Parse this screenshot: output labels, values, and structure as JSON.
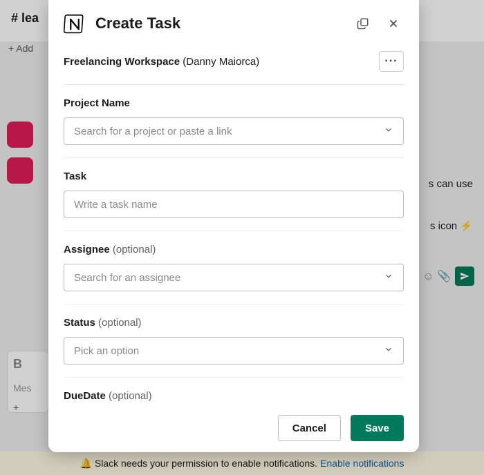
{
  "background": {
    "channel_prefix": "# lea",
    "add_label": "+  Add",
    "right_text_1": "s can use",
    "right_text_2": "s icon  ⚡",
    "composer_placeholder": "Mes",
    "notif_text": "Slack needs your permission to enable notifications.",
    "notif_link": "Enable notifications"
  },
  "modal": {
    "title": "Create Task",
    "workspace_name": "Freelancing Workspace",
    "workspace_user": "(Danny Maiorca)",
    "more_label": "···",
    "fields": {
      "project": {
        "label": "Project Name",
        "placeholder": "Search for a project or paste a link"
      },
      "task": {
        "label": "Task",
        "placeholder": "Write a task name"
      },
      "assignee": {
        "label": "Assignee",
        "optional": "(optional)",
        "placeholder": "Search for an assignee"
      },
      "status": {
        "label": "Status",
        "optional": "(optional)",
        "placeholder": "Pick an option"
      },
      "duedate": {
        "label": "DueDate",
        "optional": "(optional)"
      }
    },
    "footer": {
      "cancel": "Cancel",
      "save": "Save"
    }
  }
}
